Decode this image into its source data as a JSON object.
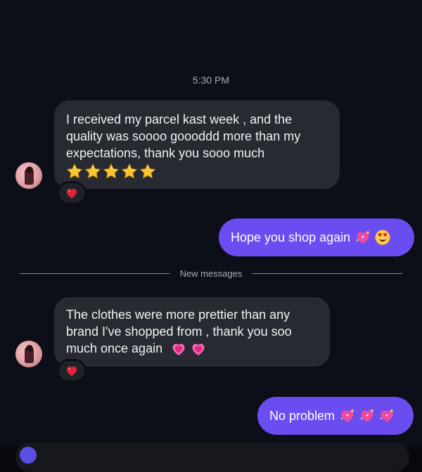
{
  "chat": {
    "timestamp": "5:30 PM",
    "divider_label": "New messages",
    "messages": [
      {
        "direction": "incoming",
        "text": "I received my parcel kast week , and the quality was soooo goooddd more than my expectations, thank you sooo much",
        "emoji": [
          "star",
          "star",
          "star",
          "star",
          "star"
        ],
        "reaction": "red-heart"
      },
      {
        "direction": "outgoing",
        "text": "Hope you shop again",
        "emoji": [
          "sparkling-heart",
          "heart-eyes-face"
        ]
      },
      {
        "direction": "incoming",
        "text": "The clothes were more prettier than any brand I've shopped from , thank you soo much once again",
        "emoji": [
          "growing-heart",
          "growing-heart"
        ],
        "reaction": "red-heart"
      },
      {
        "direction": "outgoing",
        "text": "No problem",
        "emoji": [
          "sparkling-heart",
          "sparkling-heart",
          "sparkling-heart"
        ]
      }
    ]
  },
  "colors": {
    "background": "#0c0f17",
    "incoming_bubble": "#272a31",
    "outgoing_bubble": "#6b4cf0",
    "heart": "#e0243a",
    "star": "#f7c62c",
    "pink_heart": "#f04aa0"
  }
}
